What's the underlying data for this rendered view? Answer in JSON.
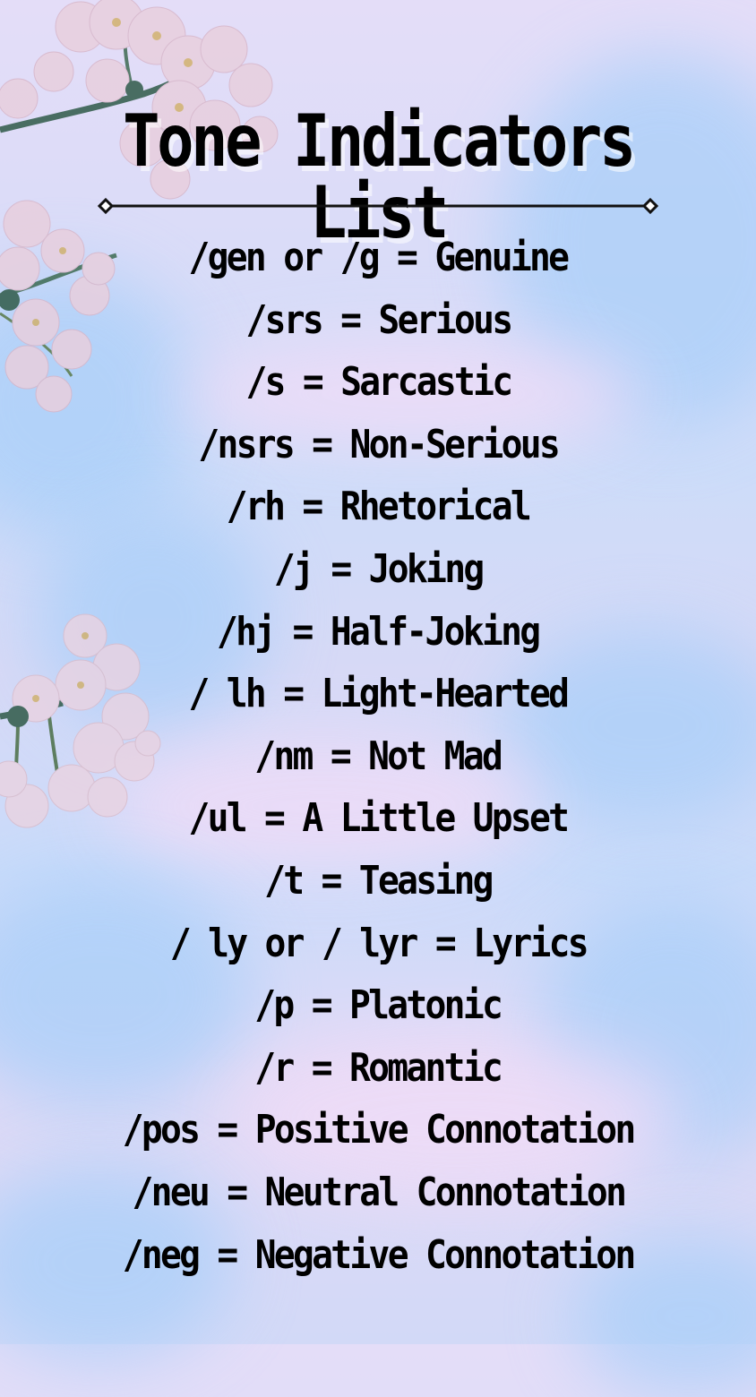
{
  "title": "Tone Indicators List",
  "colors": {
    "text": "#000000",
    "sky_blue": "#a9cff9",
    "sky_lavender": "#e4ddf8",
    "blossom_pink": "#e6cfe0"
  },
  "decorations": {
    "divider": "diamond-ended-line",
    "blossoms": [
      "top-left-cherry-blossom-branch",
      "mid-left-cherry-blossom-cluster"
    ]
  },
  "indicators": [
    {
      "text": "/gen or /g = Genuine"
    },
    {
      "text": "/srs = Serious"
    },
    {
      "text": "/s = Sarcastic"
    },
    {
      "text": "/nsrs = Non-Serious"
    },
    {
      "text": "/rh = Rhetorical"
    },
    {
      "text": "/j = Joking"
    },
    {
      "text": "/hj = Half-Joking"
    },
    {
      "text": "/ lh = Light-Hearted"
    },
    {
      "text": "/nm = Not Mad"
    },
    {
      "text": "/ul = A Little Upset"
    },
    {
      "text": "/t = Teasing"
    },
    {
      "text": "/ ly or / lyr = Lyrics"
    },
    {
      "text": "/p = Platonic"
    },
    {
      "text": "/r = Romantic"
    },
    {
      "text": "/pos = Positive Connotation"
    },
    {
      "text": "/neu = Neutral Connotation"
    },
    {
      "text": "/neg = Negative Connotation"
    }
  ]
}
